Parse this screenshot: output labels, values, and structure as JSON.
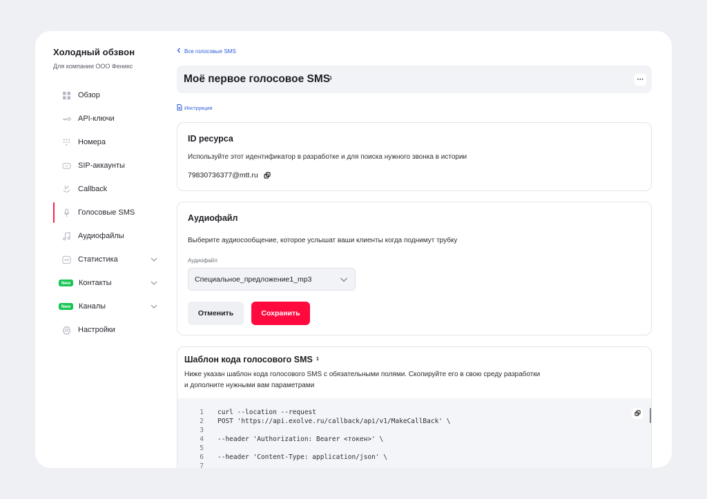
{
  "sidebar": {
    "title": "Холодный обзвон",
    "subtitle": "Для компании ООО Феникс",
    "items": [
      {
        "label": "Обзор",
        "icon": "grid-icon"
      },
      {
        "label": "API-ключи",
        "icon": "key-icon"
      },
      {
        "label": "Номера",
        "icon": "dialpad-icon"
      },
      {
        "label": "SIP-аккаунты",
        "icon": "sip-icon"
      },
      {
        "label": "Callback",
        "icon": "callback-icon"
      },
      {
        "label": "Голосовые SMS",
        "icon": "microphone-icon",
        "active": true
      },
      {
        "label": "Аудиофайлы",
        "icon": "music-note-icon"
      },
      {
        "label": "Статистика",
        "icon": "chart-icon",
        "expandable": true
      },
      {
        "label": "Контакты",
        "badge": "New",
        "expandable": true
      },
      {
        "label": "Каналы",
        "badge": "New",
        "expandable": true
      },
      {
        "label": "Настройки",
        "icon": "gear-icon"
      }
    ]
  },
  "main": {
    "back_link": "Все голосовые SMS",
    "title": "Моё первое голосовое SMS",
    "title_count": "1",
    "more_label": "···",
    "instruction_link": "Инструкция",
    "resource_card": {
      "title": "ID ресурса",
      "description": "Используйте этот идентификатор в разработке и для поиска нужного звонка в истории",
      "resource_id": "79830736377@mtt.ru"
    },
    "audio_card": {
      "title": "Аудиофайл",
      "description": "Выберите аудиосообщение, которое услышат ваши клиенты когда поднимут трубку",
      "field_label": "Аудиофайл",
      "selected_value": "Специальное_предложение1_mp3",
      "cancel_label": "Отменить",
      "save_label": "Сохранить"
    },
    "template_card": {
      "title": "Шаблон кода голосового SMS",
      "title_count": "1",
      "description": "Ниже указан шаблон кода голосового SMS с обязательными полями. Скопируйте его в свою среду разработки и дополните нужными вам параметрами",
      "code_lines": [
        {
          "n": "1",
          "text": "curl --location --request"
        },
        {
          "n": "2",
          "text": "POST 'https://api.exolve.ru/callback/api/v1/MakeCallBack' \\"
        },
        {
          "n": "3",
          "text": ""
        },
        {
          "n": "4",
          "text": "--header 'Authorization: Bearer <токен>' \\"
        },
        {
          "n": "5",
          "text": ""
        },
        {
          "n": "6",
          "text": "--header 'Content-Type: application/json' \\"
        },
        {
          "n": "7",
          "text": ""
        }
      ]
    }
  },
  "colors": {
    "accent": "#ff0a3f",
    "link": "#2a5bd7",
    "badge_new": "#17c653"
  }
}
